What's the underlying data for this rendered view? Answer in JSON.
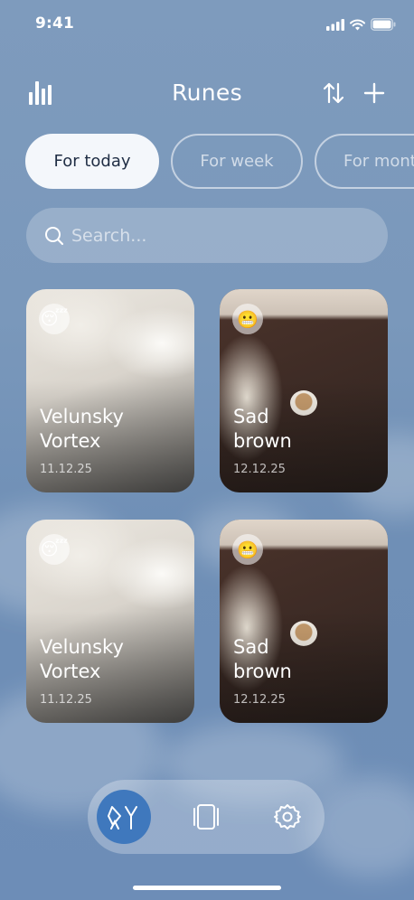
{
  "status": {
    "time": "9:41"
  },
  "header": {
    "title": "Runes",
    "left_icon": "bar-chart-icon",
    "sort_icon": "sort-arrows-icon",
    "add_icon": "plus-icon"
  },
  "filters": [
    {
      "label": "For today",
      "active": true
    },
    {
      "label": "For week",
      "active": false
    },
    {
      "label": "For month",
      "active": false
    }
  ],
  "search": {
    "placeholder": "Search..."
  },
  "cards": [
    {
      "title_line1": "Velunsky",
      "title_line2": "Vortex",
      "date": "11.12.25",
      "emoji": "😴",
      "photo": "white-bedding"
    },
    {
      "title_line1": "Sad",
      "title_line2": "brown",
      "date": "12.12.25",
      "emoji": "😬",
      "photo": "brown-bedding"
    },
    {
      "title_line1": "Velunsky",
      "title_line2": "Vortex",
      "date": "11.12.25",
      "emoji": "😴",
      "photo": "white-bedding"
    },
    {
      "title_line1": "Sad",
      "title_line2": "brown",
      "date": "12.12.25",
      "emoji": "😬",
      "photo": "brown-bedding"
    }
  ],
  "tabbar": {
    "items": [
      "runes-icon",
      "cards-icon",
      "gear-icon"
    ],
    "active": "runes-icon",
    "accent": "#3f78bd"
  }
}
